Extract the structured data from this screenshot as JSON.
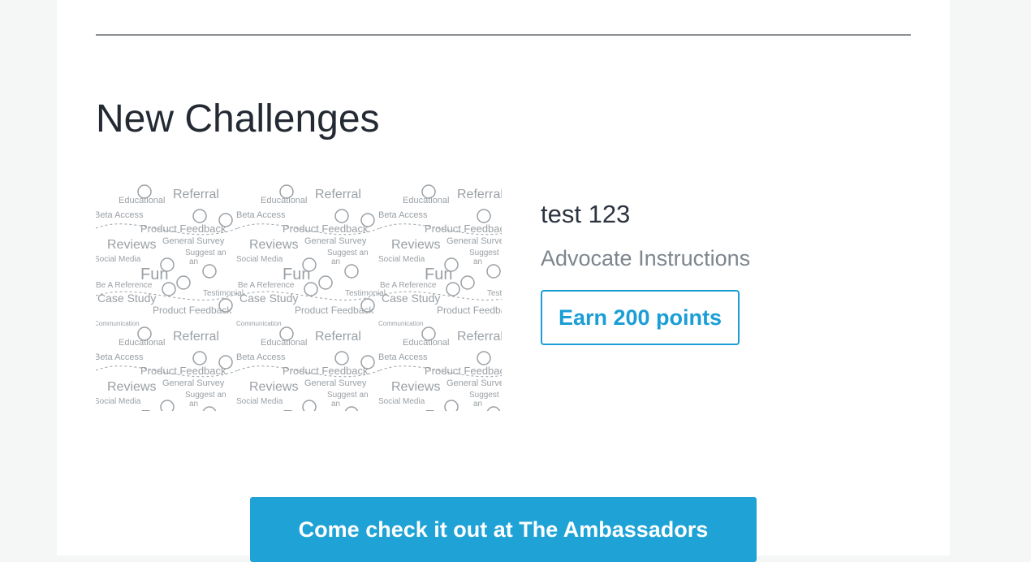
{
  "section": {
    "title": "New Challenges"
  },
  "challenge": {
    "title": "test 123",
    "instructions": "Advocate Instructions",
    "points_button": "Earn 200 points",
    "image": {
      "description_words": [
        "Referral",
        "Educational",
        "Beta Access",
        "Product Feedback",
        "General Survey",
        "Reviews",
        "Social Media",
        "Suggest an Advocate",
        "Fun",
        "Be A Reference",
        "Testimonial",
        "Case Study",
        "Communication"
      ]
    }
  },
  "cta": {
    "label": "Come check it out at The Ambassadors"
  },
  "colors": {
    "accent": "#1a9ed5",
    "cta_bg": "#1fa3d6",
    "title": "#232a33",
    "muted": "#7d858d",
    "pattern": "#9aa0a5"
  }
}
